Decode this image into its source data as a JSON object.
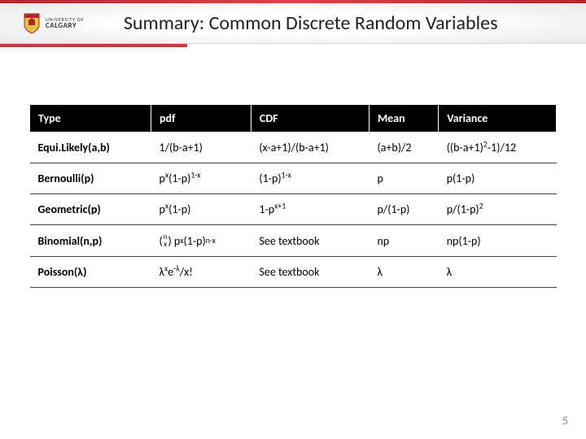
{
  "header": {
    "logo_top": "UNIVERSITY OF",
    "logo_bottom": "CALGARY",
    "title": "Summary: Common Discrete Random Variables"
  },
  "table": {
    "headers": [
      "Type",
      "pdf",
      "CDF",
      "Mean",
      "Variance"
    ],
    "rows": [
      {
        "type": "Equi.Likely(a,b)",
        "pdf_html": "1/(b-a+1)",
        "cdf_html": "(x-a+1)/(b-a+1)",
        "mean_html": "(a+b)/2",
        "var_html": "((b-a+1)<sup>2</sup>-1)/12"
      },
      {
        "type": "Bernoulli(p)",
        "pdf_html": "p<sup>x</sup>(1-p)<sup>1-x</sup>",
        "cdf_html": "(1-p)<sup>1-x</sup>",
        "mean_html": "p",
        "var_html": "p(1-p)"
      },
      {
        "type": "Geometric(p)",
        "pdf_html": "p<sup>x</sup>(1-p)",
        "cdf_html": "1-p<sup>x+1</sup>",
        "mean_html": "p/(1-p)",
        "var_html": "p/(1-p)<sup>2</sup>"
      },
      {
        "type": "Binomial(n,p)",
        "pdf_html": "<span class='binom'>(<span class='binom-col'><span>n</span><span>x</span></span>) p<sup>x</sup>(1-p)<sup>n-x</sup></span>",
        "cdf_html": "See textbook",
        "mean_html": "np",
        "var_html": "np(1-p)"
      },
      {
        "type": "Poisson(λ)",
        "pdf_html": "λ<sup>x</sup>e<sup>-λ</sup>/x!",
        "cdf_html": "See textbook",
        "mean_html": "λ",
        "var_html": "λ"
      }
    ]
  },
  "page_number": "5",
  "chart_data": {
    "type": "table",
    "columns": [
      "Type",
      "pdf",
      "CDF",
      "Mean",
      "Variance"
    ],
    "rows": [
      [
        "Equi.Likely(a,b)",
        "1/(b-a+1)",
        "(x-a+1)/(b-a+1)",
        "(a+b)/2",
        "((b-a+1)^2-1)/12"
      ],
      [
        "Bernoulli(p)",
        "p^x(1-p)^(1-x)",
        "(1-p)^(1-x)",
        "p",
        "p(1-p)"
      ],
      [
        "Geometric(p)",
        "p^x(1-p)",
        "1-p^(x+1)",
        "p/(1-p)",
        "p/(1-p)^2"
      ],
      [
        "Binomial(n,p)",
        "C(n,x) p^x(1-p)^(n-x)",
        "See textbook",
        "np",
        "np(1-p)"
      ],
      [
        "Poisson(λ)",
        "λ^x e^-λ / x!",
        "See textbook",
        "λ",
        "λ"
      ]
    ]
  }
}
